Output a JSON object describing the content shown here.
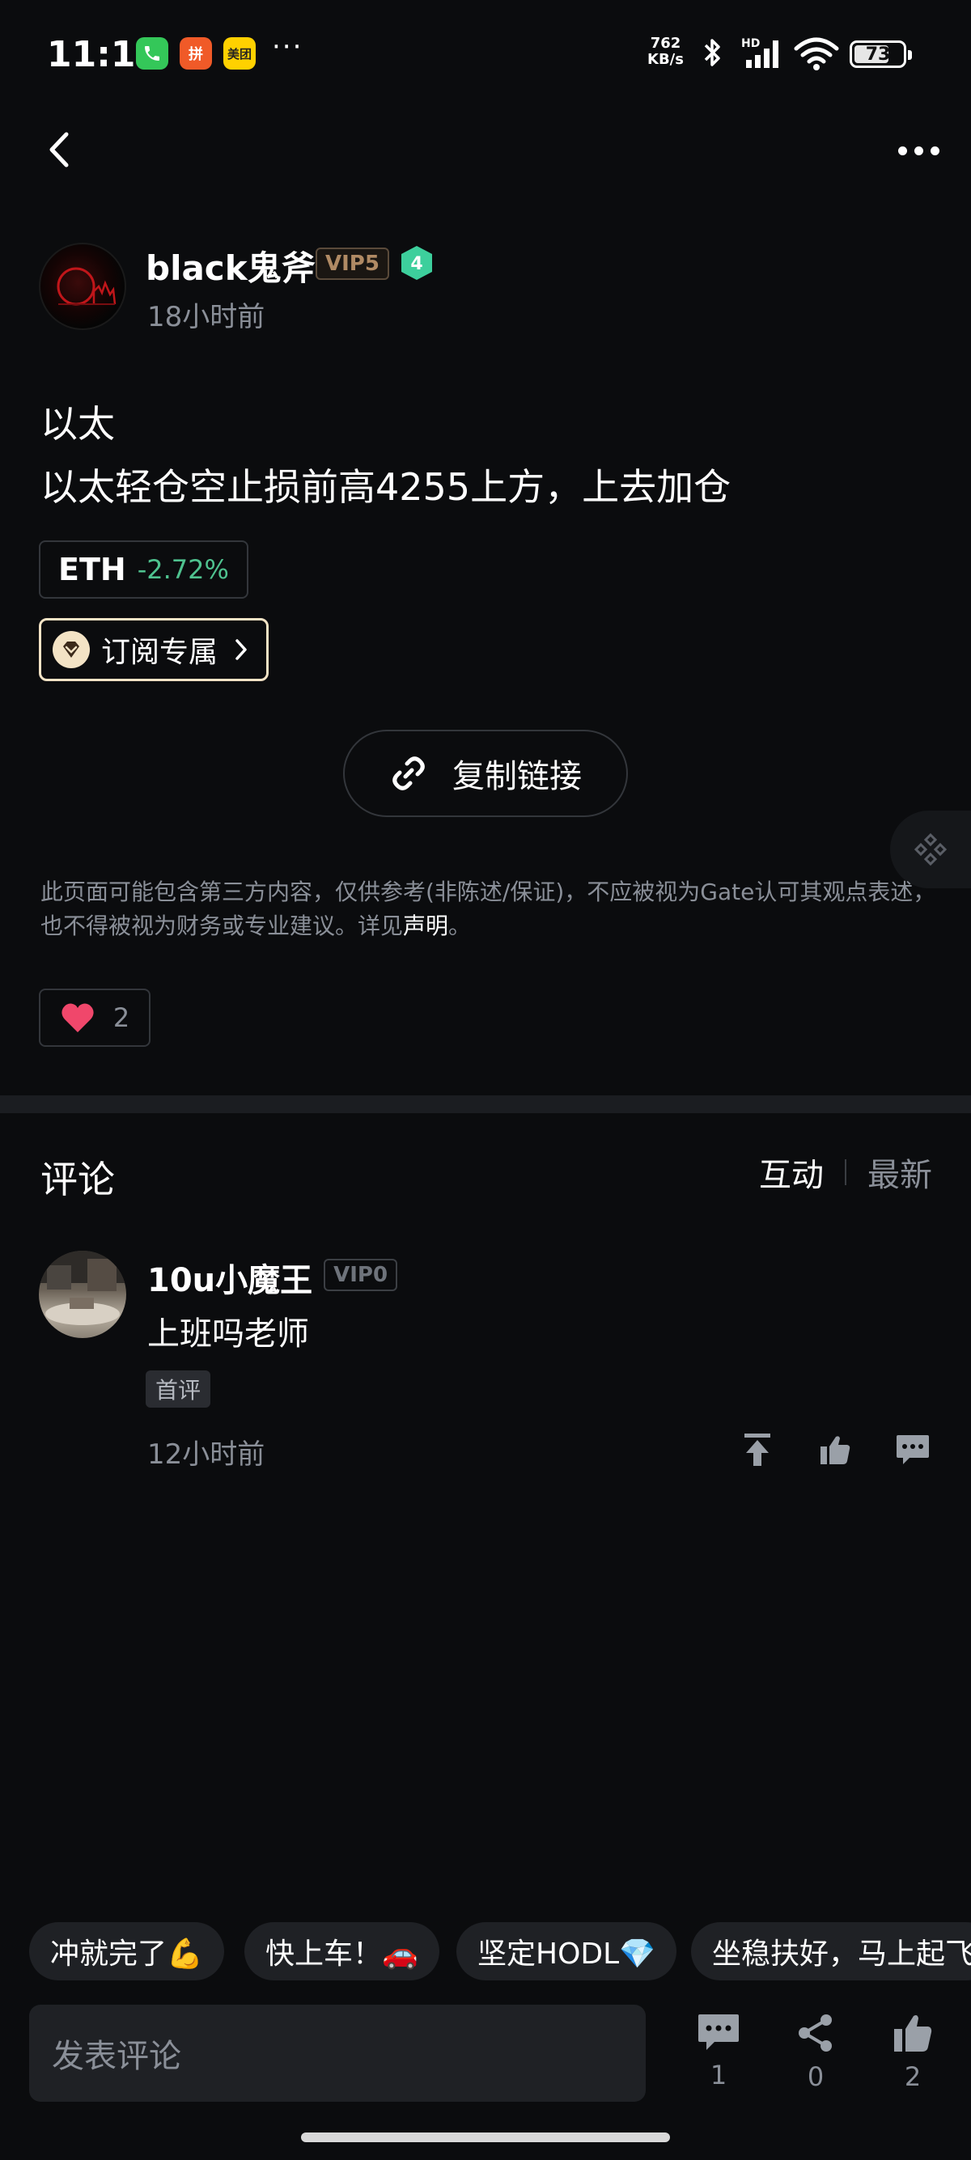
{
  "status_bar": {
    "time": "11:16",
    "apps": [
      {
        "name": "phone-app-icon",
        "color": "#34c759",
        "label": "☎"
      },
      {
        "name": "pinduoduo-app-icon",
        "color": "#f05a28",
        "label": "拼"
      },
      {
        "name": "meituan-app-icon",
        "color": "#ffd100",
        "label": "美团"
      }
    ],
    "more": "···",
    "net_speed_value": "762",
    "net_speed_unit": "KB/s",
    "signal_label": "HD",
    "battery": "73"
  },
  "author": {
    "name": "black鬼斧",
    "vip": "VIP5",
    "level": "4",
    "time": "18小时前"
  },
  "post": {
    "line1": "以太",
    "line2": "以太轻仓空止损前高4255上方，上去加仓"
  },
  "coin_tag": {
    "symbol": "ETH",
    "change": "-2.72%",
    "change_color": "#4fc28f"
  },
  "subscribe": {
    "label": "订阅专属"
  },
  "copy_link": {
    "label": "复制链接"
  },
  "disclaimer": {
    "text": "此页面可能包含第三方内容，仅供参考(非陈述/保证)，不应被视为Gate认可其观点表述，也不得被视为财务或专业建议。详见",
    "link": "声明",
    "end": "。"
  },
  "likes": {
    "count": "2"
  },
  "comments": {
    "title": "评论",
    "tabs": [
      "互动",
      "最新"
    ],
    "items": [
      {
        "user": "10u小魔王",
        "vip": "VIP0",
        "text": "上班吗老师",
        "badge": "首评",
        "time": "12小时前"
      }
    ]
  },
  "quick_replies": [
    "冲就完了💪",
    "快上车！🚗",
    "坚定HODL💎",
    "坐稳扶好，马上起飞"
  ],
  "bottom_bar": {
    "placeholder": "发表评论",
    "comment_count": "1",
    "share_count": "0",
    "like_count": "2"
  }
}
